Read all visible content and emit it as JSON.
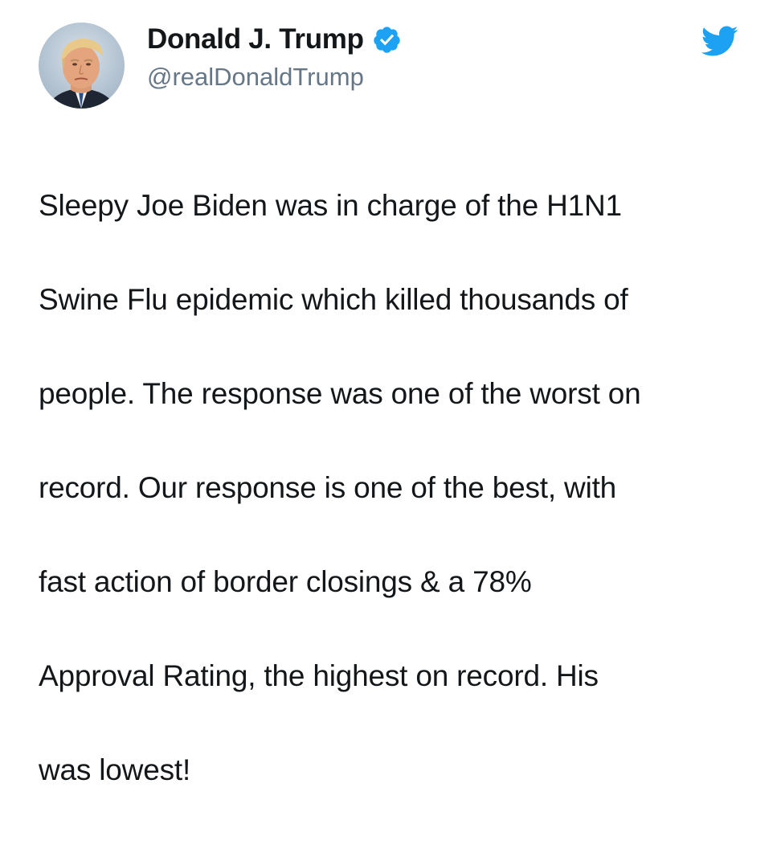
{
  "tweet": {
    "author": {
      "display_name": "Donald J. Trump",
      "handle": "@realDonaldTrump",
      "verified": true,
      "avatar_icon": "profile-photo-avatar"
    },
    "text_lines": [
      "Sleepy Joe Biden was in charge of the H1N1",
      "Swine Flu epidemic which killed thousands of",
      "people. The response was one of the worst on",
      "record. Our response is one of the best, with",
      "fast action of border closings & a 78%",
      "Approval Rating, the highest on record. His",
      "was lowest!"
    ]
  },
  "icons": {
    "verified": "verified-badge-icon",
    "brand": "twitter-bird-icon"
  },
  "colors": {
    "brand_blue": "#1da1f2",
    "text_primary": "#14171a",
    "text_secondary": "#657786",
    "background": "#ffffff"
  }
}
